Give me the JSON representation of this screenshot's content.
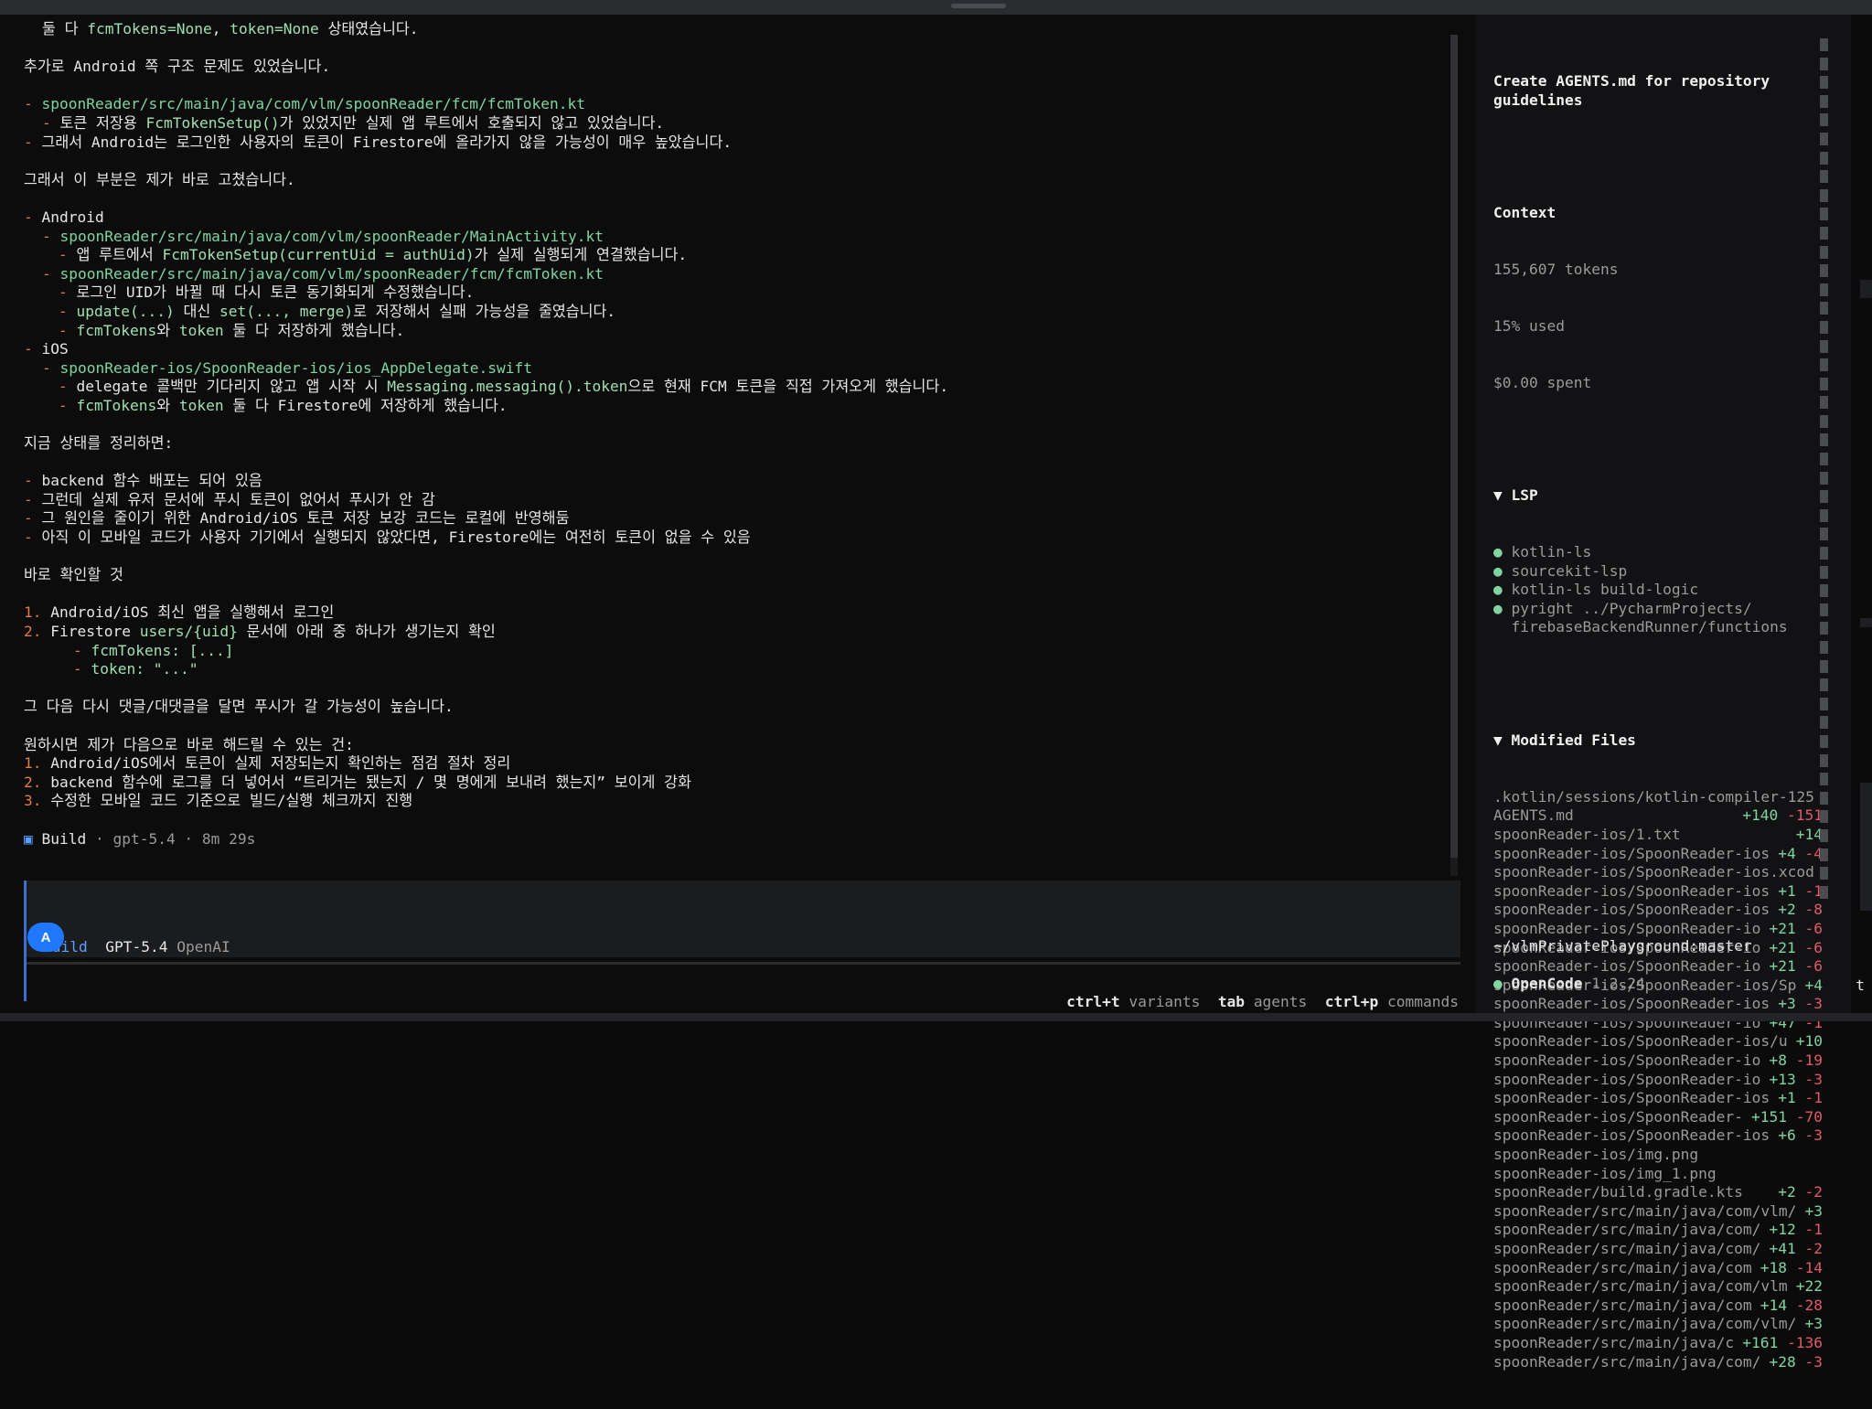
{
  "transcript": {
    "lines": [
      {
        "indent": "in1",
        "parts": [
          {
            "t": "둘 다 "
          },
          {
            "t": "fcmTokens=None",
            "c": "cd"
          },
          {
            "t": ", "
          },
          {
            "t": "token=None",
            "c": "cd"
          },
          {
            "t": " 상태였습니다."
          }
        ]
      },
      {
        "parts": []
      },
      {
        "parts": [
          {
            "t": "추가로 Android 쪽 구조 문제도 있었습니다."
          }
        ]
      },
      {
        "parts": []
      },
      {
        "parts": [
          {
            "t": "- ",
            "c": "mk"
          },
          {
            "t": "spoonReader/src/main/java/com/vlm/spoonReader/fcm/fcmToken.kt",
            "c": "pth"
          }
        ]
      },
      {
        "indent": "in1",
        "parts": [
          {
            "t": "- ",
            "c": "mk"
          },
          {
            "t": "토큰 저장용 "
          },
          {
            "t": "FcmTokenSetup()",
            "c": "cd"
          },
          {
            "t": "가 있었지만 실제 앱 루트에서 호출되지 않고 있었습니다."
          }
        ]
      },
      {
        "parts": [
          {
            "t": "- ",
            "c": "mk"
          },
          {
            "t": "그래서 Android는 로그인한 사용자의 토큰이 Firestore에 올라가지 않을 가능성이 매우 높았습니다."
          }
        ]
      },
      {
        "parts": []
      },
      {
        "parts": [
          {
            "t": "그래서 이 부분은 제가 바로 고쳤습니다."
          }
        ]
      },
      {
        "parts": []
      },
      {
        "parts": [
          {
            "t": "- ",
            "c": "mk"
          },
          {
            "t": "Android"
          }
        ]
      },
      {
        "indent": "in1",
        "parts": [
          {
            "t": "- ",
            "c": "mk"
          },
          {
            "t": "spoonReader/src/main/java/com/vlm/spoonReader/MainActivity.kt",
            "c": "pth"
          }
        ]
      },
      {
        "indent": "in2",
        "parts": [
          {
            "t": "- ",
            "c": "mk"
          },
          {
            "t": "앱 루트에서 "
          },
          {
            "t": "FcmTokenSetup(currentUid = authUid)",
            "c": "cd"
          },
          {
            "t": "가 실제 실행되게 연결했습니다."
          }
        ]
      },
      {
        "indent": "in1",
        "parts": [
          {
            "t": "- ",
            "c": "mk"
          },
          {
            "t": "spoonReader/src/main/java/com/vlm/spoonReader/fcm/fcmToken.kt",
            "c": "pth"
          }
        ]
      },
      {
        "indent": "in2",
        "parts": [
          {
            "t": "- ",
            "c": "mk"
          },
          {
            "t": "로그인 UID가 바뀔 때 다시 토큰 동기화되게 수정했습니다."
          }
        ]
      },
      {
        "indent": "in2",
        "parts": [
          {
            "t": "- ",
            "c": "mk"
          },
          {
            "t": "update(...)",
            "c": "cd"
          },
          {
            "t": " 대신 "
          },
          {
            "t": "set(..., merge)",
            "c": "cd"
          },
          {
            "t": "로 저장해서 실패 가능성을 줄였습니다."
          }
        ]
      },
      {
        "indent": "in2",
        "parts": [
          {
            "t": "- ",
            "c": "mk"
          },
          {
            "t": "fcmTokens",
            "c": "cd"
          },
          {
            "t": "와 "
          },
          {
            "t": "token",
            "c": "cd"
          },
          {
            "t": " 둘 다 저장하게 했습니다."
          }
        ]
      },
      {
        "parts": [
          {
            "t": "- ",
            "c": "mk"
          },
          {
            "t": "iOS"
          }
        ]
      },
      {
        "indent": "in1",
        "parts": [
          {
            "t": "- ",
            "c": "mk"
          },
          {
            "t": "spoonReader-ios/SpoonReader-ios/ios_AppDelegate.swift",
            "c": "pth"
          }
        ]
      },
      {
        "indent": "in2",
        "parts": [
          {
            "t": "- ",
            "c": "mk"
          },
          {
            "t": "delegate 콜백만 기다리지 않고 앱 시작 시 "
          },
          {
            "t": "Messaging.messaging().token",
            "c": "cd"
          },
          {
            "t": "으로 현재 FCM 토큰을 직접 가져오게 했습니다."
          }
        ]
      },
      {
        "indent": "in2",
        "parts": [
          {
            "t": "- ",
            "c": "mk"
          },
          {
            "t": "fcmTokens",
            "c": "cd"
          },
          {
            "t": "와 "
          },
          {
            "t": "token",
            "c": "cd"
          },
          {
            "t": " 둘 다 Firestore에 저장하게 했습니다."
          }
        ]
      },
      {
        "parts": []
      },
      {
        "parts": [
          {
            "t": "지금 상태를 정리하면:"
          }
        ]
      },
      {
        "parts": []
      },
      {
        "parts": [
          {
            "t": "- ",
            "c": "mk"
          },
          {
            "t": "backend 함수 배포는 되어 있음"
          }
        ]
      },
      {
        "parts": [
          {
            "t": "- ",
            "c": "mk"
          },
          {
            "t": "그런데 실제 유저 문서에 푸시 토큰이 없어서 푸시가 안 감"
          }
        ]
      },
      {
        "parts": [
          {
            "t": "- ",
            "c": "mk"
          },
          {
            "t": "그 원인을 줄이기 위한 Android/iOS 토큰 저장 보강 코드는 로컬에 반영해둠"
          }
        ]
      },
      {
        "parts": [
          {
            "t": "- ",
            "c": "mk"
          },
          {
            "t": "아직 이 모바일 코드가 사용자 기기에서 실행되지 않았다면, Firestore에는 여전히 토큰이 없을 수 있음"
          }
        ]
      },
      {
        "parts": []
      },
      {
        "parts": [
          {
            "t": "바로 확인할 것"
          }
        ]
      },
      {
        "parts": []
      },
      {
        "parts": [
          {
            "t": "1. ",
            "c": "num"
          },
          {
            "t": "Android/iOS 최신 앱을 실행해서 로그인"
          }
        ]
      },
      {
        "parts": [
          {
            "t": "2. ",
            "c": "num"
          },
          {
            "t": "Firestore "
          },
          {
            "t": "users/{uid}",
            "c": "cd"
          },
          {
            "t": " 문서에 아래 중 하나가 생기는지 확인"
          }
        ]
      },
      {
        "indent": "in3",
        "parts": [
          {
            "t": "- ",
            "c": "mk"
          },
          {
            "t": "fcmTokens: [...]",
            "c": "cd"
          }
        ]
      },
      {
        "indent": "in3",
        "parts": [
          {
            "t": "- ",
            "c": "mk"
          },
          {
            "t": "token: \"...\"",
            "c": "cd"
          }
        ]
      },
      {
        "parts": []
      },
      {
        "parts": [
          {
            "t": "그 다음 다시 댓글/대댓글을 달면 푸시가 갈 가능성이 높습니다."
          }
        ]
      },
      {
        "parts": []
      },
      {
        "parts": [
          {
            "t": "원하시면 제가 다음으로 바로 해드릴 수 있는 건:"
          }
        ]
      },
      {
        "parts": [
          {
            "t": "1. ",
            "c": "num"
          },
          {
            "t": "Android/iOS에서 토큰이 실제 저장되는지 확인하는 점검 절차 정리"
          }
        ]
      },
      {
        "parts": [
          {
            "t": "2. ",
            "c": "num"
          },
          {
            "t": "backend 함수에 로그를 더 넣어서 “트리거는 됐는지 / 몇 명에게 보내려 했는지” 보이게 강화"
          }
        ]
      },
      {
        "parts": [
          {
            "t": "3. ",
            "c": "num"
          },
          {
            "t": "수정한 모바일 코드 기준으로 빌드/실행 체크까지 진행"
          }
        ]
      },
      {
        "parts": []
      },
      {
        "parts": [
          {
            "t": "▣ ",
            "c": "buildsq"
          },
          {
            "t": "Build"
          },
          {
            "t": " · gpt-5.4 · 8m 29s",
            "c": "muted"
          }
        ]
      }
    ]
  },
  "input": {
    "avatar": "A",
    "agent": "Build",
    "model": "GPT-5.4",
    "provider": "OpenAI"
  },
  "hints": [
    {
      "key": "ctrl+t",
      "label": "variants"
    },
    {
      "key": "tab",
      "label": "agents"
    },
    {
      "key": "ctrl+p",
      "label": "commands"
    }
  ],
  "sidebar": {
    "title": "Create AGENTS.md for repository guidelines",
    "context_header": "Context",
    "tokens": "155,607 tokens",
    "used": "15% used",
    "spent": "$0.00 spent",
    "lsp_header": "▼ LSP",
    "lsp": [
      "kotlin-ls",
      "sourcekit-lsp",
      "kotlin-ls build-logic",
      "pyright ../PycharmProjects/",
      "firebaseBackendRunner/functions"
    ],
    "files_header": "▼ Modified Files",
    "files": [
      {
        "p": ".kotlin/sessions/kotlin-compiler-125",
        "a": "",
        "d": ""
      },
      {
        "p": "AGENTS.md",
        "a": "+140",
        "d": "-151"
      },
      {
        "p": "spoonReader-ios/1.txt",
        "a": "+14",
        "d": ""
      },
      {
        "p": "spoonReader-ios/SpoonReader-ios",
        "a": "+4",
        "d": "-4"
      },
      {
        "p": "spoonReader-ios/SpoonReader-ios.xcod",
        "a": "",
        "d": ""
      },
      {
        "p": "spoonReader-ios/SpoonReader-ios",
        "a": "+1",
        "d": "-1"
      },
      {
        "p": "spoonReader-ios/SpoonReader-ios",
        "a": "+2",
        "d": "-8"
      },
      {
        "p": "spoonReader-ios/SpoonReader-io",
        "a": "+21",
        "d": "-6"
      },
      {
        "p": "spoonReader-ios/SpoonReader-io",
        "a": "+21",
        "d": "-6"
      },
      {
        "p": "spoonReader-ios/SpoonReader-io",
        "a": "+21",
        "d": "-6"
      },
      {
        "p": "spoonReader-ios/SpoonReader-ios/Sp",
        "a": "+4",
        "d": ""
      },
      {
        "p": "spoonReader-ios/SpoonReader-ios",
        "a": "+3",
        "d": "-3"
      },
      {
        "p": "spoonReader-ios/SpoonReader-io",
        "a": "+47",
        "d": "-1"
      },
      {
        "p": "spoonReader-ios/SpoonReader-ios/u",
        "a": "+10",
        "d": ""
      },
      {
        "p": "spoonReader-ios/SpoonReader-io",
        "a": "+8",
        "d": "-19"
      },
      {
        "p": "spoonReader-ios/SpoonReader-io",
        "a": "+13",
        "d": "-3"
      },
      {
        "p": "spoonReader-ios/SpoonReader-ios",
        "a": "+1",
        "d": "-1"
      },
      {
        "p": "spoonReader-ios/SpoonReader-",
        "a": "+151",
        "d": "-70"
      },
      {
        "p": "spoonReader-ios/SpoonReader-ios",
        "a": "+6",
        "d": "-3"
      },
      {
        "p": "spoonReader-ios/img.png",
        "a": "",
        "d": ""
      },
      {
        "p": "spoonReader-ios/img_1.png",
        "a": "",
        "d": ""
      },
      {
        "p": "spoonReader/build.gradle.kts",
        "a": "+2",
        "d": "-2"
      },
      {
        "p": "spoonReader/src/main/java/com/vlm/",
        "a": "+3",
        "d": ""
      },
      {
        "p": "spoonReader/src/main/java/com/",
        "a": "+12",
        "d": "-1"
      },
      {
        "p": "spoonReader/src/main/java/com/",
        "a": "+41",
        "d": "-2"
      },
      {
        "p": "spoonReader/src/main/java/com",
        "a": "+18",
        "d": "-14"
      },
      {
        "p": "spoonReader/src/main/java/com/vlm",
        "a": "+22",
        "d": ""
      },
      {
        "p": "spoonReader/src/main/java/com",
        "a": "+14",
        "d": "-28"
      },
      {
        "p": "spoonReader/src/main/java/com/vlm/",
        "a": "+3",
        "d": ""
      },
      {
        "p": "spoonReader/src/main/java/c",
        "a": "+161",
        "d": "-136"
      },
      {
        "p": "spoonReader/src/main/java/com/",
        "a": "+28",
        "d": "-3"
      }
    ],
    "cwd": "~/vlmPrivatePlayground:master",
    "app_name_a": "Open",
    "app_name_b": "Code",
    "version": "1.2.24"
  },
  "right_edge_char": "t",
  "colors": {
    "accent": "#3d6fd0",
    "green": "#7fd4a0",
    "red": "#e05a6a",
    "orange": "#e07a4a"
  }
}
